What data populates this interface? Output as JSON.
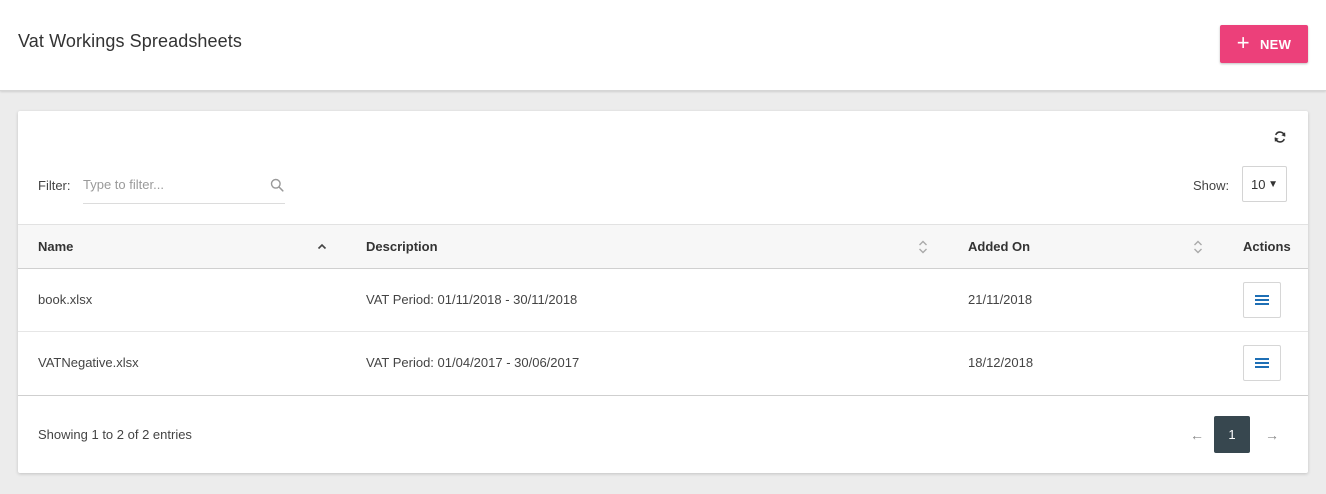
{
  "header": {
    "title": "Vat Workings Spreadsheets",
    "new_button": {
      "icon": "plus-icon",
      "label": "NEW"
    }
  },
  "toolbar": {
    "refresh_icon": "refresh-icon",
    "filter_label": "Filter:",
    "filter_placeholder": "Type to filter...",
    "filter_value": "",
    "search_icon": "search-icon",
    "show_label": "Show:",
    "show_value": "10"
  },
  "table": {
    "columns": [
      {
        "label": "Name",
        "sort": "ascending"
      },
      {
        "label": "Description",
        "sort": "none"
      },
      {
        "label": "Added On",
        "sort": "none"
      },
      {
        "label": "Actions",
        "sort": null
      }
    ],
    "rows": [
      {
        "name": "book.xlsx",
        "description": "VAT Period: 01/11/2018 - 30/11/2018",
        "added_on": "21/11/2018",
        "action_icon": "menu-icon"
      },
      {
        "name": "VATNegative.xlsx",
        "description": "VAT Period: 01/04/2017 - 30/06/2017",
        "added_on": "18/12/2018",
        "action_icon": "menu-icon"
      }
    ]
  },
  "footer": {
    "entries_text": "Showing 1 to 2 of 2 entries",
    "pagination": {
      "prev": "←",
      "current": "1",
      "next": "→"
    }
  },
  "colors": {
    "accent": "#ec407a",
    "pagination_active": "#37474f",
    "action_icon": "#1e6fb5"
  }
}
